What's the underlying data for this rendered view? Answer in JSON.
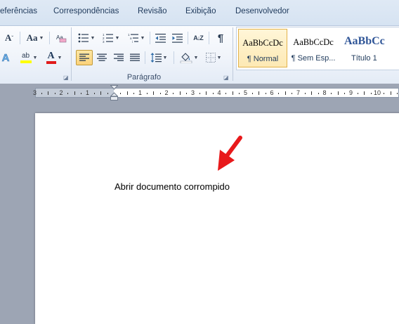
{
  "tabs": [
    "eferências",
    "Correspondências",
    "Revisão",
    "Exibição",
    "Desenvolvedor"
  ],
  "ribbon": {
    "font_buttons": {
      "shrink": "A",
      "change_case": "Aa",
      "highlight": "ab",
      "font_color": "A"
    },
    "paragraph_group_label": "Parágrafo",
    "pilcrow": "¶",
    "sort": "A↓Z",
    "styles": [
      {
        "sample": "AaBbCcDc",
        "name": "¶ Normal",
        "selected": true
      },
      {
        "sample": "AaBbCcDc",
        "name": "¶ Sem Esp...",
        "selected": false
      },
      {
        "sample": "AaBbCc",
        "name": "Título 1",
        "selected": false
      }
    ]
  },
  "ruler": {
    "labels": [
      "3",
      "2",
      "1",
      "1",
      "2",
      "3",
      "4",
      "5",
      "6",
      "7",
      "8",
      "9",
      "10"
    ]
  },
  "document": {
    "text": "Abrir documento corrompido"
  },
  "colors": {
    "arrow": "#e8191b",
    "highlight": "#ffff00",
    "font_color": "#e01b1b",
    "active_button": "#fbd27a"
  }
}
